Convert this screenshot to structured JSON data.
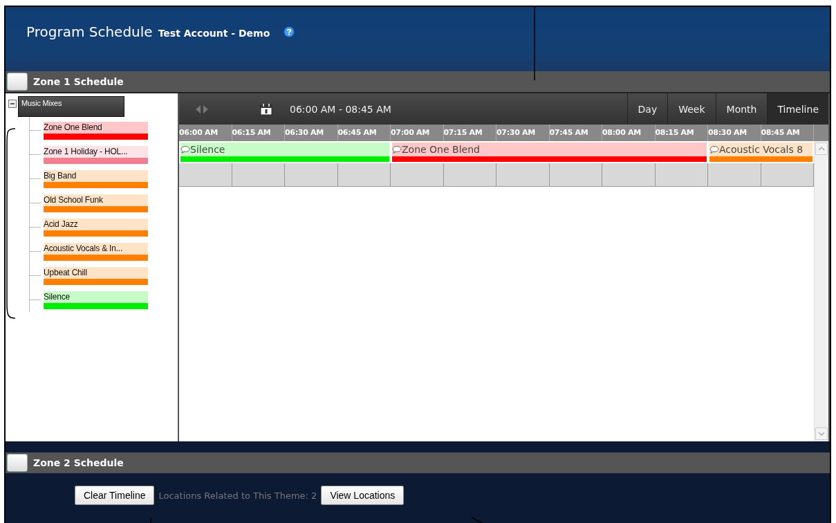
{
  "header": {
    "title": "Program Schedule",
    "subtitle": "Test Account - Demo"
  },
  "zones": [
    {
      "title": "Zone 1 Schedule"
    },
    {
      "title": "Zone 2 Schedule"
    }
  ],
  "tree": {
    "label": "Music Mixes",
    "expanded": true,
    "children": [
      {
        "label": "Zone One Blend",
        "color": "#ff0000"
      },
      {
        "label": "Zone 1 Holiday - HOL...",
        "color": "#f08090"
      },
      {
        "label": "Big Band",
        "color": "#ff8000"
      },
      {
        "label": "Old School Funk",
        "color": "#ff8000"
      },
      {
        "label": "Acid Jazz",
        "color": "#ff8000"
      },
      {
        "label": "Acoustic Vocals & In...",
        "color": "#ff8000"
      },
      {
        "label": "Upbeat Chill",
        "color": "#ff8000"
      },
      {
        "label": "Silence",
        "color": "#00ee00"
      }
    ]
  },
  "toolbar": {
    "range": "06:00 AM - 08:45 AM"
  },
  "views": [
    {
      "label": "Day",
      "selected": false
    },
    {
      "label": "Week",
      "selected": false
    },
    {
      "label": "Month",
      "selected": false
    },
    {
      "label": "Timeline",
      "selected": true
    }
  ],
  "time_columns": [
    "06:00 AM",
    "06:15 AM",
    "06:30 AM",
    "06:45 AM",
    "07:00 AM",
    "07:15 AM",
    "07:30 AM",
    "07:45 AM",
    "08:00 AM",
    "08:15 AM",
    "08:30 AM",
    "08:45 AM"
  ],
  "blocks": [
    {
      "label": "Silence",
      "color": "#00ee00"
    },
    {
      "label": "Zone One Blend",
      "color": "#ff0000"
    },
    {
      "label": "Acoustic Vocals 8",
      "color": "#ff8000"
    }
  ],
  "footer": {
    "clear_button": "Clear Timeline",
    "locations_text": "Locations Related to This Theme: 2",
    "view_button": "View Locations"
  }
}
